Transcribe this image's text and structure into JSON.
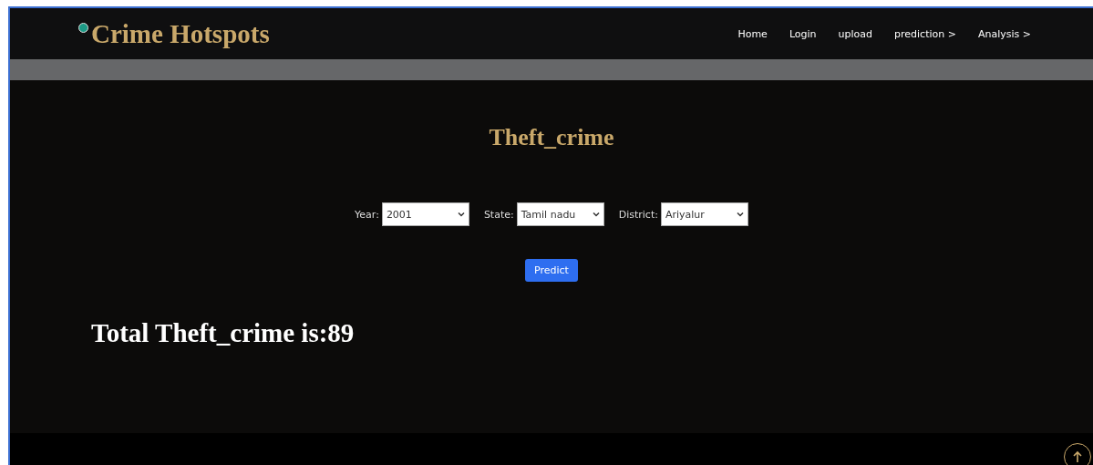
{
  "brand": {
    "title": "Crime Hotspots"
  },
  "nav": [
    {
      "label": "Home"
    },
    {
      "label": "Login"
    },
    {
      "label": "upload"
    },
    {
      "label": "prediction >"
    },
    {
      "label": "Analysis >"
    }
  ],
  "page_title": "Theft_crime",
  "filters": [
    {
      "label": "Year:",
      "value": "2001"
    },
    {
      "label": "State:",
      "value": "Tamil nadu"
    },
    {
      "label": "District:",
      "value": "Ariyalur"
    }
  ],
  "predict_button": "Predict",
  "result": "Total Theft_crime is:89"
}
